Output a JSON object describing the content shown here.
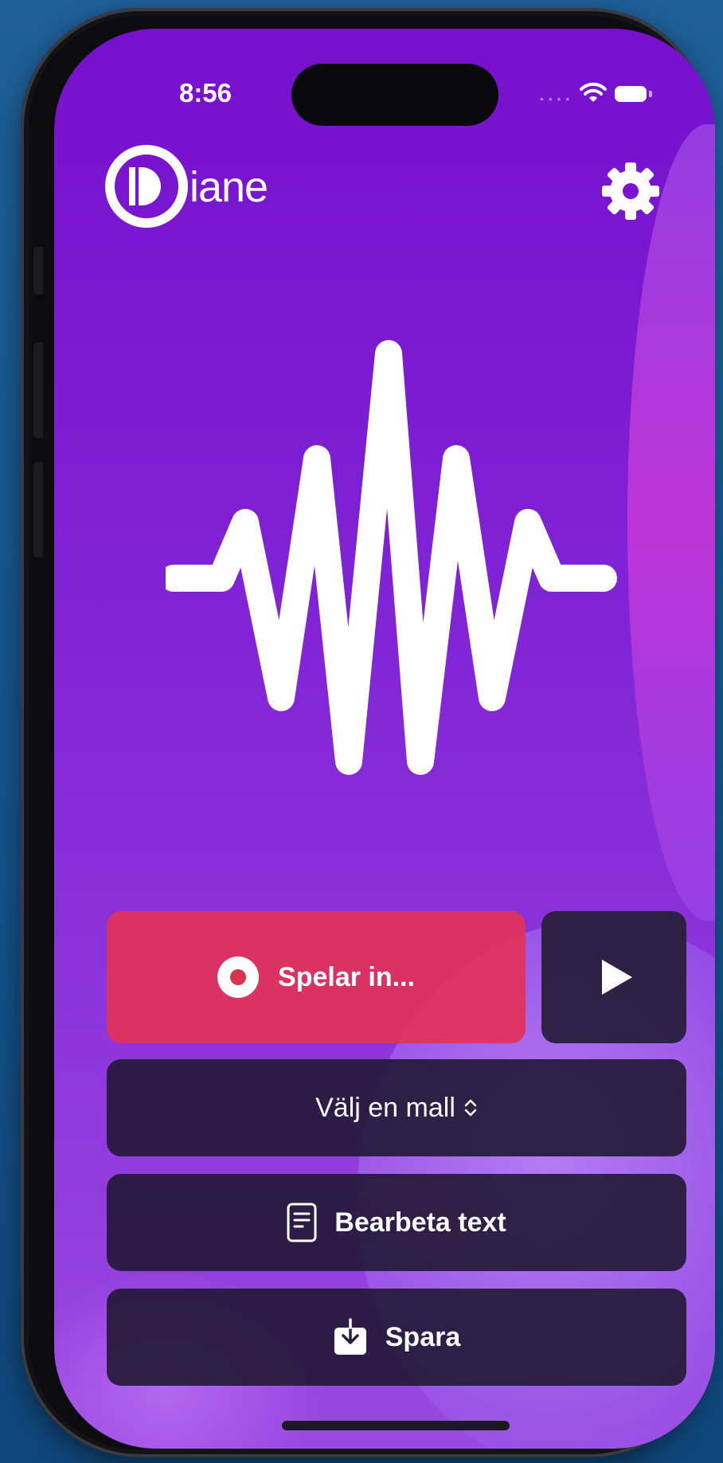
{
  "status_bar": {
    "time": "8:56"
  },
  "header": {
    "logo_text": "iane",
    "settings_icon": "gear-icon"
  },
  "visualizer": {
    "icon": "audio-waveform-icon"
  },
  "controls": {
    "record_label": "Spelar in...",
    "record_icon": "record-icon",
    "play_icon": "play-icon",
    "template_label": "Välj en mall",
    "template_icon": "chevron-up-down-icon",
    "process_label": "Bearbeta text",
    "process_icon": "document-icon",
    "save_label": "Spara",
    "save_icon": "download-tray-icon"
  },
  "colors": {
    "background_top": "#7610cd",
    "background_bottom": "#9a48df",
    "record_button": "#e2325a",
    "dark_button": "#241a38"
  }
}
